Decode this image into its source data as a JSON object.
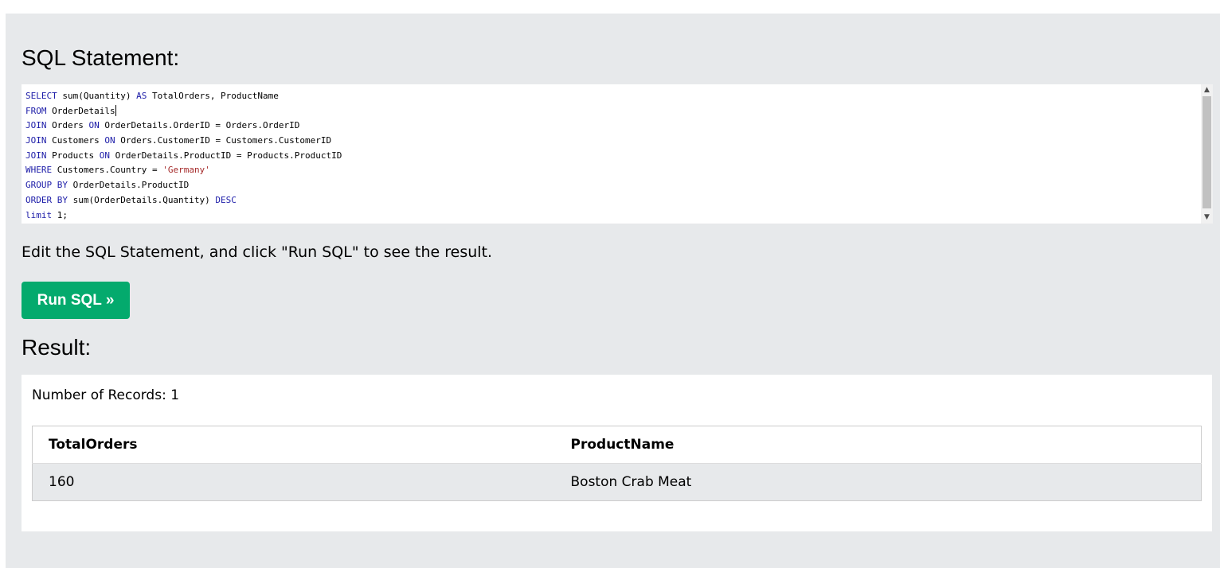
{
  "sql_section": {
    "heading": "SQL Statement:",
    "code_lines": [
      [
        {
          "t": "SELECT",
          "k": "kw"
        },
        {
          "t": " sum(Quantity) "
        },
        {
          "t": "AS",
          "k": "kw"
        },
        {
          "t": " TotalOrders, ProductName"
        }
      ],
      [
        {
          "t": "FROM",
          "k": "kw"
        },
        {
          "t": " OrderDetails"
        }
      ],
      [
        {
          "t": "JOIN",
          "k": "kw"
        },
        {
          "t": " Orders "
        },
        {
          "t": "ON",
          "k": "kw"
        },
        {
          "t": " OrderDetails.OrderID = Orders.OrderID"
        }
      ],
      [
        {
          "t": "JOIN",
          "k": "kw"
        },
        {
          "t": " Customers "
        },
        {
          "t": "ON",
          "k": "kw"
        },
        {
          "t": " Orders.CustomerID = Customers.CustomerID"
        }
      ],
      [
        {
          "t": "JOIN",
          "k": "kw"
        },
        {
          "t": " Products "
        },
        {
          "t": "ON",
          "k": "kw"
        },
        {
          "t": " OrderDetails.ProductID = Products.ProductID"
        }
      ],
      [
        {
          "t": "WHERE",
          "k": "kw"
        },
        {
          "t": " Customers.Country = "
        },
        {
          "t": "'Germany'",
          "k": "str"
        }
      ],
      [
        {
          "t": "GROUP BY",
          "k": "kw"
        },
        {
          "t": " OrderDetails.ProductID"
        }
      ],
      [
        {
          "t": "ORDER BY",
          "k": "kw"
        },
        {
          "t": " sum(OrderDetails.Quantity) "
        },
        {
          "t": "DESC",
          "k": "kw"
        }
      ],
      [
        {
          "t": "limit",
          "k": "kw"
        },
        {
          "t": " 1;"
        }
      ]
    ],
    "cursor_line": 1,
    "instruction": "Edit the SQL Statement, and click \"Run SQL\" to see the result.",
    "run_button_label": "Run SQL »",
    "scroll_up_icon": "chevron-up-icon",
    "scroll_down_icon": "chevron-down-icon"
  },
  "result_section": {
    "heading": "Result:",
    "record_count": "Number of Records: 1",
    "columns": [
      "TotalOrders",
      "ProductName"
    ],
    "rows": [
      [
        "160",
        "Boston Crab Meat"
      ]
    ]
  },
  "colors": {
    "panel_background": "#e7e9eb",
    "run_button": "#04aa6d",
    "sql_keyword": "#1c1ca8",
    "sql_string": "#a52a2a"
  }
}
